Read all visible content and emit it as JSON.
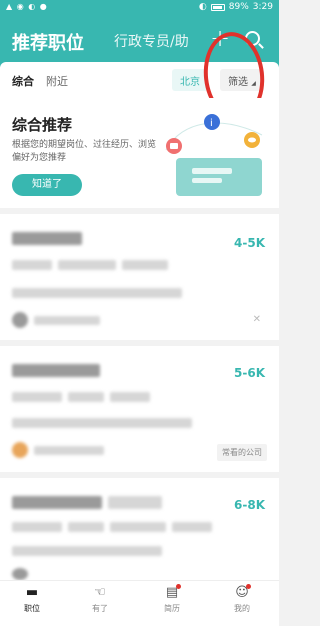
{
  "statusbar": {
    "time": "3:29",
    "battery": "89%"
  },
  "header": {
    "title": "推荐职位",
    "alt_tab": "行政专员/助"
  },
  "filters": {
    "tabs": [
      "综合",
      "附近"
    ],
    "city": "北京",
    "filter": "筛选"
  },
  "recommend": {
    "title": "综合推荐",
    "desc": "根据您的期望岗位、过往经历、浏览偏好为您推荐",
    "button": "知道了"
  },
  "jobs": [
    {
      "salary": "4-5K"
    },
    {
      "salary": "5-6K",
      "tag": "常看的公司"
    },
    {
      "salary": "6-8K"
    }
  ],
  "nav": {
    "items": [
      "职位",
      "有了",
      "简历",
      "我的"
    ]
  }
}
